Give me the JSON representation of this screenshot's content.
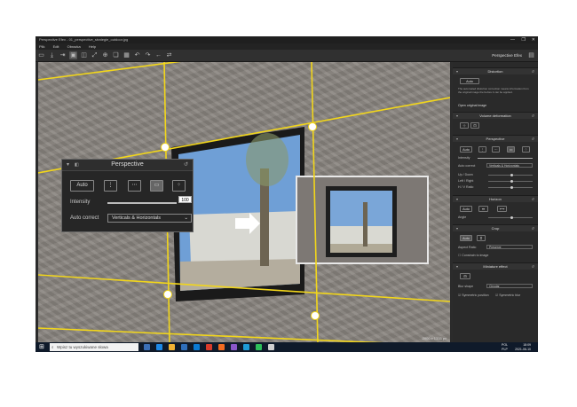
{
  "window": {
    "title": "Perspective Efex - 01_perspective_strategie_outdoor.jpg",
    "controls": [
      "—",
      "❐",
      "✕"
    ]
  },
  "menu": [
    "Plik",
    "Edit",
    "Obrazka",
    "Help"
  ],
  "brand": {
    "name": "Perspective Efex"
  },
  "canvas": {
    "dimensions": "2000 x 1333 px"
  },
  "overlay": {
    "title": "Perspective",
    "auto_label": "Auto",
    "intensity_label": "Intensity",
    "intensity_value": "100",
    "autocorrect_label": "Auto correct",
    "autocorrect_value": "Verticals & Horizontals"
  },
  "panel": {
    "distortion": {
      "title": "Distortion",
      "auto_label": "Auto",
      "info": "The automated distortion correction means information from the original image the before it can be applied.",
      "open_link": "Open original image"
    },
    "volume": {
      "title": "Volume deformation"
    },
    "perspective": {
      "title": "Perspective",
      "auto_label": "Auto",
      "intensity_label": "Intensity",
      "autocorrect_label": "Auto correct",
      "autocorrect_value": "Verticals & Horizontals",
      "updown_label": "Up / Down",
      "leftright_label": "Left / Right",
      "hv_label": "H / V Ratio"
    },
    "horizon": {
      "title": "Horizon",
      "auto_label": "Auto",
      "angle_label": "Angle"
    },
    "crop": {
      "title": "Crop",
      "auto_label": "Auto",
      "aspect_label": "Aspect Ratio",
      "aspect_value": "Preserve",
      "constrain_label": "Constrain to image"
    },
    "miniature": {
      "title": "Miniature effect",
      "blur_label": "Blur shape",
      "blur_value": "Circular",
      "sym_position": "Symmetric position",
      "sym_blur": "Symmetric blur"
    }
  },
  "taskbar": {
    "search_placeholder": "Wpisz tu wyszukiwane słowa",
    "lang_top": "POL",
    "lang_bottom": "PLP",
    "time": "18:09",
    "date": "2021-06-10"
  },
  "colors": {
    "accent": "#f2d61a",
    "panel_bg": "#2a2a2a",
    "taskbar_bg": "#0f1a2a"
  }
}
